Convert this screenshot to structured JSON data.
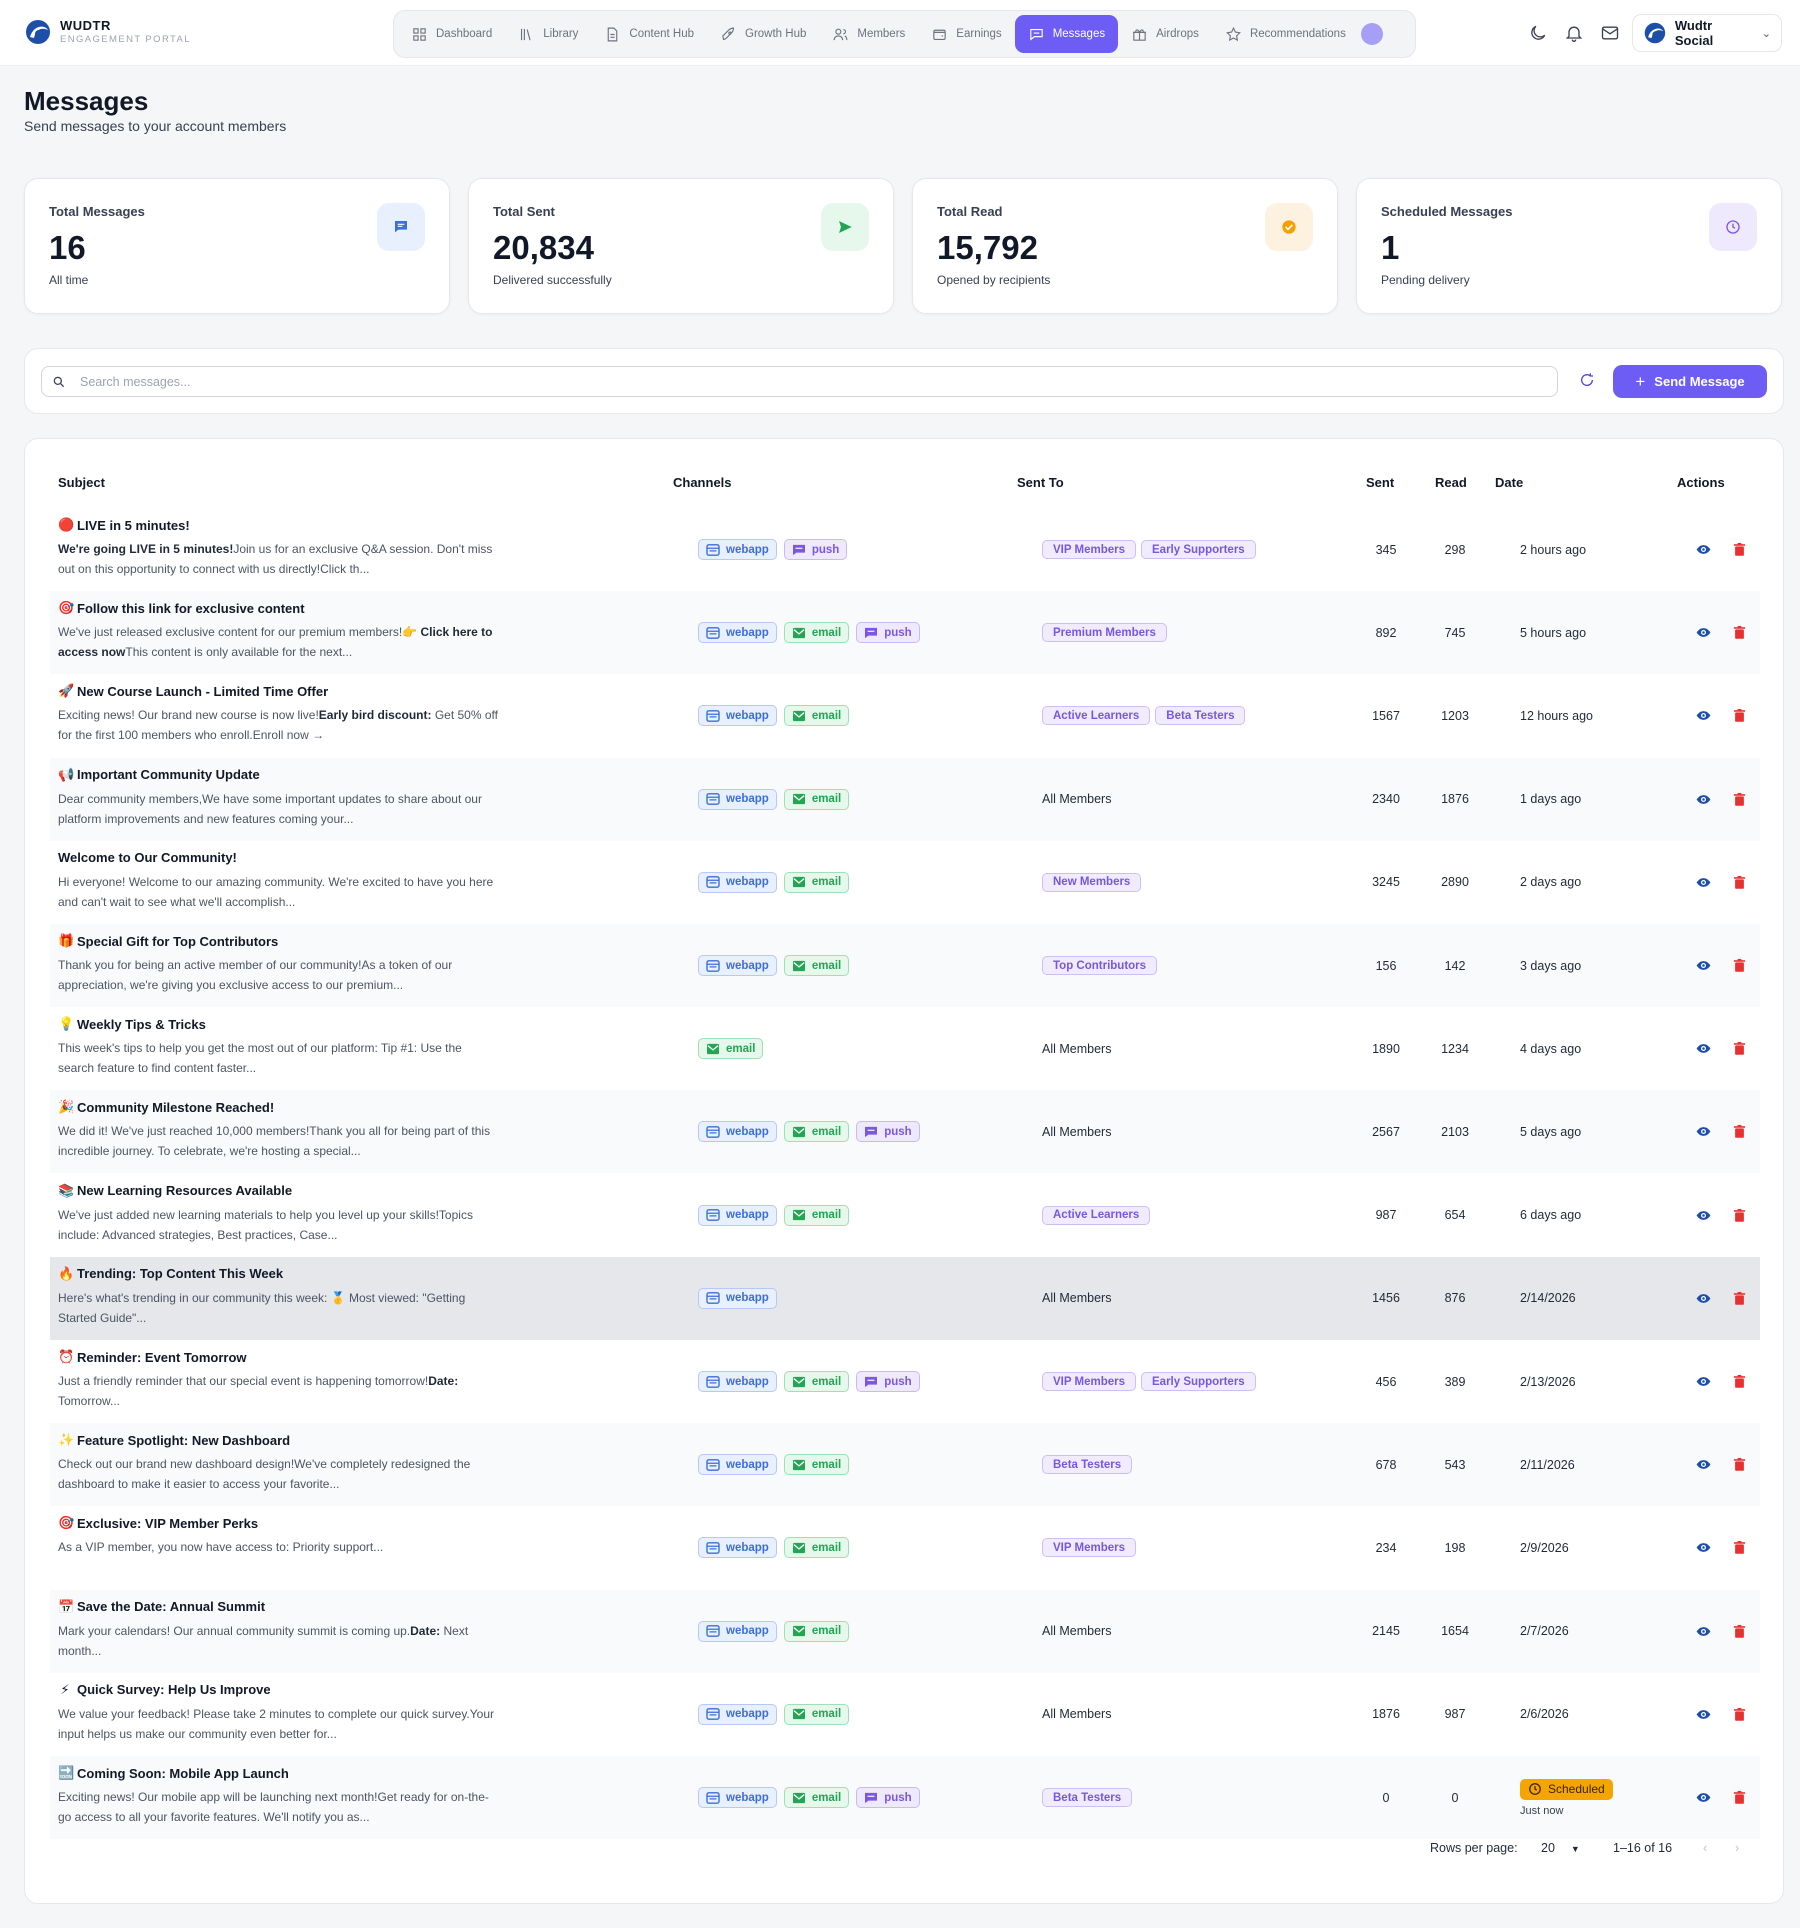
{
  "brand": {
    "name": "WUDTR",
    "sub": "ENGAGEMENT PORTAL"
  },
  "nav": [
    {
      "label": "Dashboard",
      "icon": "grid-icon"
    },
    {
      "label": "Library",
      "icon": "library-icon"
    },
    {
      "label": "Content Hub",
      "icon": "document-icon"
    },
    {
      "label": "Growth Hub",
      "icon": "rocket-icon"
    },
    {
      "label": "Members",
      "icon": "users-icon"
    },
    {
      "label": "Earnings",
      "icon": "wallet-icon"
    },
    {
      "label": "Messages",
      "icon": "chat-icon",
      "active": true
    },
    {
      "label": "Airdrops",
      "icon": "gift-icon"
    },
    {
      "label": "Recommendations",
      "icon": "star-icon"
    }
  ],
  "account": {
    "name": "Wudtr Social"
  },
  "page": {
    "title": "Messages",
    "subtitle": "Send messages to your account members"
  },
  "stats": [
    {
      "label": "Total Messages",
      "value": "16",
      "note": "All time",
      "icon": "message-icon",
      "color": "#3b6fd8",
      "bg": "#e8effd"
    },
    {
      "label": "Total Sent",
      "value": "20,834",
      "note": "Delivered successfully",
      "icon": "send-icon",
      "color": "#22a653",
      "bg": "#e6f7ec"
    },
    {
      "label": "Total Read",
      "value": "15,792",
      "note": "Opened by recipients",
      "icon": "check-circle-icon",
      "color": "#f5a000",
      "bg": "#fdf1df"
    },
    {
      "label": "Scheduled Messages",
      "value": "1",
      "note": "Pending delivery",
      "icon": "clock-icon",
      "color": "#7c56e6",
      "bg": "#efe9fd"
    }
  ],
  "search": {
    "placeholder": "Search messages..."
  },
  "send_button": "Send Message",
  "table": {
    "columns": [
      "Subject",
      "Channels",
      "Sent To",
      "Sent",
      "Read",
      "Date",
      "Actions"
    ],
    "rows": [
      {
        "emoji": "🔴",
        "subject": "LIVE in 5 minutes!",
        "preview": [
          {
            "b": "We're going LIVE in 5 minutes!"
          },
          {
            "t": "Join us for an exclusive Q&A session. Don't miss out on this opportunity to connect with us directly!Click th..."
          }
        ],
        "channels": [
          "webapp",
          "push"
        ],
        "audience": [
          "VIP Members",
          "Early Supporters"
        ],
        "sent": "345",
        "read": "298",
        "date": "2 hours ago"
      },
      {
        "emoji": "🎯",
        "subject": "Follow this link for exclusive content",
        "preview": [
          {
            "t": "We've just released exclusive content for our premium members!👉 "
          },
          {
            "b": "Click here to access now"
          },
          {
            "t": "This content is only available for the next..."
          }
        ],
        "channels": [
          "webapp",
          "email",
          "push"
        ],
        "audience": [
          "Premium Members"
        ],
        "sent": "892",
        "read": "745",
        "date": "5 hours ago"
      },
      {
        "emoji": "🚀",
        "subject": "New Course Launch - Limited Time Offer",
        "preview": [
          {
            "t": "Exciting news! Our brand new course is now live!"
          },
          {
            "b": "Early bird discount:"
          },
          {
            "t": " Get 50% off for the first 100 members who enroll.Enroll now →"
          }
        ],
        "channels": [
          "webapp",
          "email"
        ],
        "audience": [
          "Active Learners",
          "Beta Testers"
        ],
        "sent": "1567",
        "read": "1203",
        "date": "12 hours ago"
      },
      {
        "emoji": "📢",
        "subject": "Important Community Update",
        "preview": [
          {
            "t": "Dear community members,We have some important updates to share about our platform improvements and new features coming your..."
          }
        ],
        "channels": [
          "webapp",
          "email"
        ],
        "audience": [],
        "all": "All Members",
        "sent": "2340",
        "read": "1876",
        "date": "1 days ago"
      },
      {
        "emoji": "",
        "subject": "Welcome to Our Community!",
        "preview": [
          {
            "t": "Hi everyone! Welcome to our amazing community. We're excited to have you here and can't wait to see what we'll accomplish..."
          }
        ],
        "channels": [
          "webapp",
          "email"
        ],
        "audience": [
          "New Members"
        ],
        "sent": "3245",
        "read": "2890",
        "date": "2 days ago"
      },
      {
        "emoji": "🎁",
        "subject": "Special Gift for Top Contributors",
        "preview": [
          {
            "t": "Thank you for being an active member of our community!As a token of our appreciation, we're giving you exclusive access to our premium..."
          }
        ],
        "channels": [
          "webapp",
          "email"
        ],
        "audience": [
          "Top Contributors"
        ],
        "sent": "156",
        "read": "142",
        "date": "3 days ago"
      },
      {
        "emoji": "💡",
        "subject": "Weekly Tips & Tricks",
        "preview": [
          {
            "t": "This week's tips to help you get the most out of our platform: Tip #1: Use the search feature to find content faster..."
          }
        ],
        "channels": [
          "email"
        ],
        "audience": [],
        "all": "All Members",
        "sent": "1890",
        "read": "1234",
        "date": "4 days ago"
      },
      {
        "emoji": "🎉",
        "subject": "Community Milestone Reached!",
        "preview": [
          {
            "t": "We did it! We've just reached 10,000 members!Thank you all for being part of this incredible journey. To celebrate, we're hosting a special..."
          }
        ],
        "channels": [
          "webapp",
          "email",
          "push"
        ],
        "audience": [],
        "all": "All Members",
        "sent": "2567",
        "read": "2103",
        "date": "5 days ago"
      },
      {
        "emoji": "📚",
        "subject": "New Learning Resources Available",
        "preview": [
          {
            "t": "We've just added new learning materials to help you level up your skills!Topics include: Advanced strategies, Best practices, Case..."
          }
        ],
        "channels": [
          "webapp",
          "email"
        ],
        "audience": [
          "Active Learners"
        ],
        "sent": "987",
        "read": "654",
        "date": "6 days ago"
      },
      {
        "emoji": "🔥",
        "subject": "Trending: Top Content This Week",
        "preview": [
          {
            "t": "Here's what's trending in our community this week: 🥇 Most viewed: \"Getting Started Guide\"..."
          }
        ],
        "channels": [
          "webapp"
        ],
        "audience": [],
        "all": "All Members",
        "sent": "1456",
        "read": "876",
        "date": "2/14/2026",
        "highlight": true
      },
      {
        "emoji": "⏰",
        "subject": "Reminder: Event Tomorrow",
        "preview": [
          {
            "t": "Just a friendly reminder that our special event is happening tomorrow!"
          },
          {
            "b": "Date:"
          },
          {
            "t": " Tomorrow..."
          }
        ],
        "channels": [
          "webapp",
          "email",
          "push"
        ],
        "audience": [
          "VIP Members",
          "Early Supporters"
        ],
        "sent": "456",
        "read": "389",
        "date": "2/13/2026"
      },
      {
        "emoji": "✨",
        "subject": "Feature Spotlight: New Dashboard",
        "preview": [
          {
            "t": "Check out our brand new dashboard design!We've completely redesigned the dashboard to make it easier to access your favorite..."
          }
        ],
        "channels": [
          "webapp",
          "email"
        ],
        "audience": [
          "Beta Testers"
        ],
        "sent": "678",
        "read": "543",
        "date": "2/11/2026"
      },
      {
        "emoji": "🎯",
        "subject": "Exclusive: VIP Member Perks",
        "preview": [
          {
            "t": "As a VIP member, you now have access to: Priority support..."
          }
        ],
        "channels": [
          "webapp",
          "email"
        ],
        "audience": [
          "VIP Members"
        ],
        "sent": "234",
        "read": "198",
        "date": "2/9/2026"
      },
      {
        "emoji": "📅",
        "subject": "Save the Date: Annual Summit",
        "preview": [
          {
            "t": "Mark your calendars! Our annual community summit is coming up."
          },
          {
            "b": "Date:"
          },
          {
            "t": " Next month..."
          }
        ],
        "channels": [
          "webapp",
          "email"
        ],
        "audience": [],
        "all": "All Members",
        "sent": "2145",
        "read": "1654",
        "date": "2/7/2026"
      },
      {
        "emoji": "⚡",
        "subject": "Quick Survey: Help Us Improve",
        "preview": [
          {
            "t": "We value your feedback! Please take 2 minutes to complete our quick survey.Your input helps us make our community even better for..."
          }
        ],
        "channels": [
          "webapp",
          "email"
        ],
        "audience": [],
        "all": "All Members",
        "sent": "1876",
        "read": "987",
        "date": "2/6/2026"
      },
      {
        "emoji": "🔜",
        "subject": "Coming Soon: Mobile App Launch",
        "preview": [
          {
            "t": "Exciting news! Our mobile app will be launching next month!Get ready for on-the-go access to all your favorite features. We'll notify you as..."
          }
        ],
        "channels": [
          "webapp",
          "email",
          "push"
        ],
        "audience": [
          "Beta Testers"
        ],
        "sent": "0",
        "read": "0",
        "date": "",
        "scheduled": {
          "badge": "Scheduled",
          "note": "Just now"
        }
      }
    ]
  },
  "pagination": {
    "rows_label": "Rows per page:",
    "rows_value": "20",
    "range": "1–16 of 16"
  }
}
